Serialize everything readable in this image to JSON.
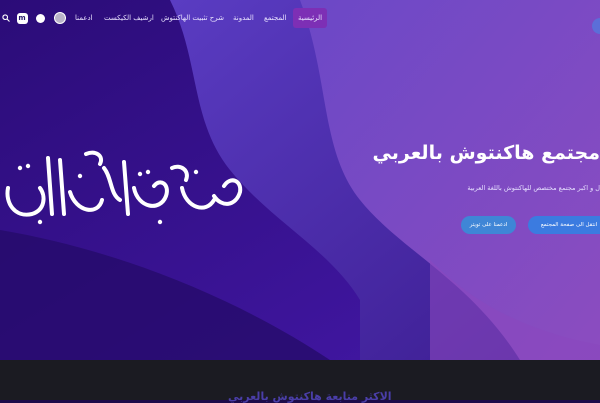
{
  "nav": {
    "items": [
      {
        "label": "الرئيسية",
        "active": true
      },
      {
        "label": "المجتمع",
        "active": false
      },
      {
        "label": "المدونة",
        "active": false
      },
      {
        "label": "شرح تثبيت الهاكنتوش",
        "active": false
      },
      {
        "label": "ارشيف الكيكست",
        "active": false
      },
      {
        "label": "ادعمنا",
        "active": false
      }
    ],
    "icons": [
      "search-icon",
      "m-logo-icon",
      "telegram-icon",
      "avatar"
    ]
  },
  "hero": {
    "title": "مجتمع هاكنتوش بالعربي",
    "subtitle": "ل و اكبر مجتمع مختصص للهاكنتوش باللغة العربية",
    "primary_button": "انتقل الى صفحة المجتمع",
    "secondary_button": "ادعمنا على تويتر",
    "calligraphy_text": "هاكنتوش بالعربي"
  },
  "bottom": {
    "partial_heading": "الاكثر متابعة هاكنتوش بالعربي"
  },
  "colors": {
    "active_nav": "#7d2fb5",
    "button": "#3b7be0",
    "hero_dark": "#2a0f6e",
    "hero_light": "#8e4fc7"
  }
}
